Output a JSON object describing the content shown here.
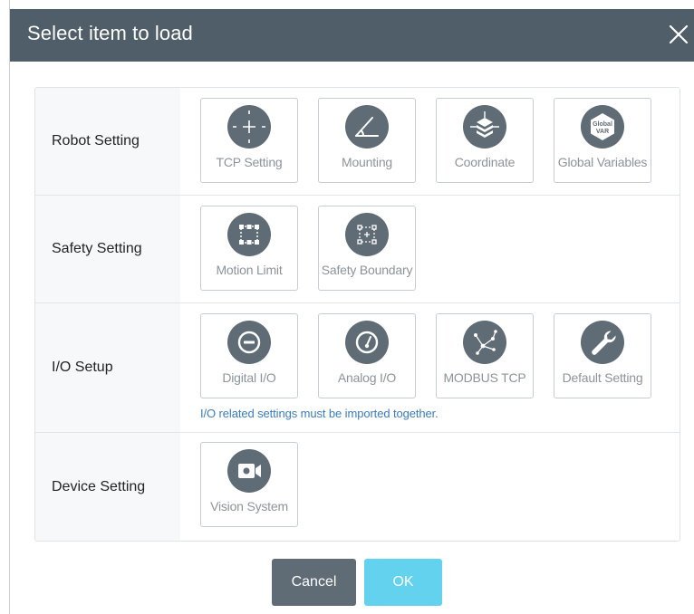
{
  "dialog": {
    "title": "Select item to load"
  },
  "rows": [
    {
      "label": "Robot Setting",
      "items": [
        "TCP Setting",
        "Mounting",
        "Coordinate",
        "Global Variables"
      ]
    },
    {
      "label": "Safety Setting",
      "items": [
        "Motion Limit",
        "Safety Boundary"
      ]
    },
    {
      "label": "I/O Setup",
      "items": [
        "Digital I/O",
        "Analog I/O",
        "MODBUS TCP",
        "Default Setting"
      ],
      "note": "I/O related settings must be imported together."
    },
    {
      "label": "Device Setting",
      "items": [
        "Vision System"
      ]
    }
  ],
  "icons": {
    "global_var_line1": "Global",
    "global_var_line2": "VAR"
  },
  "buttons": {
    "cancel": "Cancel",
    "ok": "OK"
  },
  "colors": {
    "titlebar": "#4f5e68",
    "icon_bg": "#5f6b75",
    "cancel": "#5f6b75",
    "ok": "#62d2ef",
    "note": "#3a7cbd"
  }
}
